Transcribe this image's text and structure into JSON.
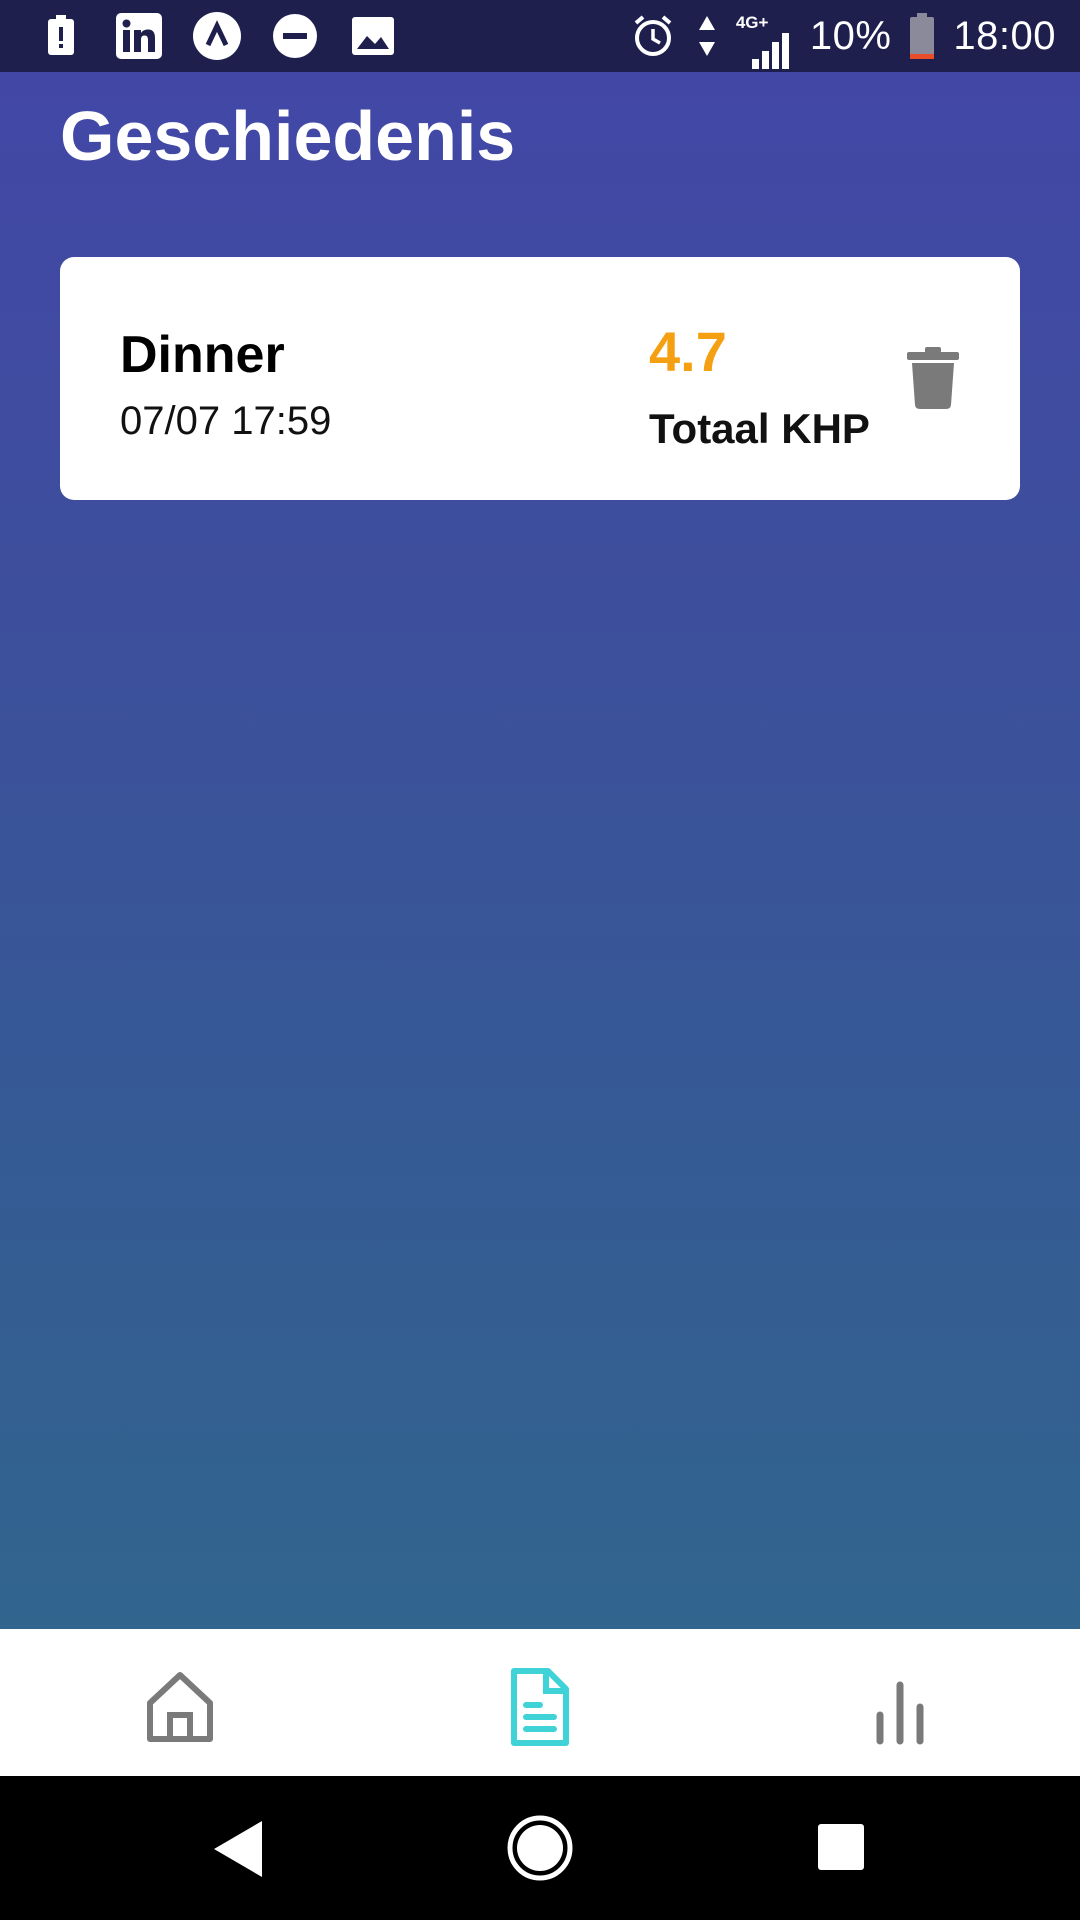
{
  "status_bar": {
    "battery_percent": "10%",
    "network": "4G+",
    "time": "18:00",
    "left_icons": [
      "alert-icon",
      "linkedin-icon",
      "caret-icon",
      "dnd-icon",
      "image-icon"
    ],
    "right_icons": [
      "alarm-icon",
      "data-arrows-icon",
      "signal-icon",
      "battery-icon"
    ]
  },
  "page": {
    "title": "Geschiedenis"
  },
  "history": [
    {
      "name": "Dinner",
      "timestamp": "07/07 17:59",
      "khp_value": "4.7",
      "khp_label": "Totaal KHP"
    }
  ],
  "bottom_nav": {
    "items": [
      {
        "icon": "home-icon",
        "active": false
      },
      {
        "icon": "document-icon",
        "active": true
      },
      {
        "icon": "bar-chart-icon",
        "active": false
      }
    ]
  },
  "colors": {
    "accent": "#f5a012",
    "active_nav": "#3fd3d8",
    "inactive_nav": "#7a7a7a",
    "gradient_top": "#4247a6",
    "gradient_bottom": "#31658e"
  },
  "system_nav": [
    "back-icon",
    "home-circle-icon",
    "recents-icon"
  ]
}
